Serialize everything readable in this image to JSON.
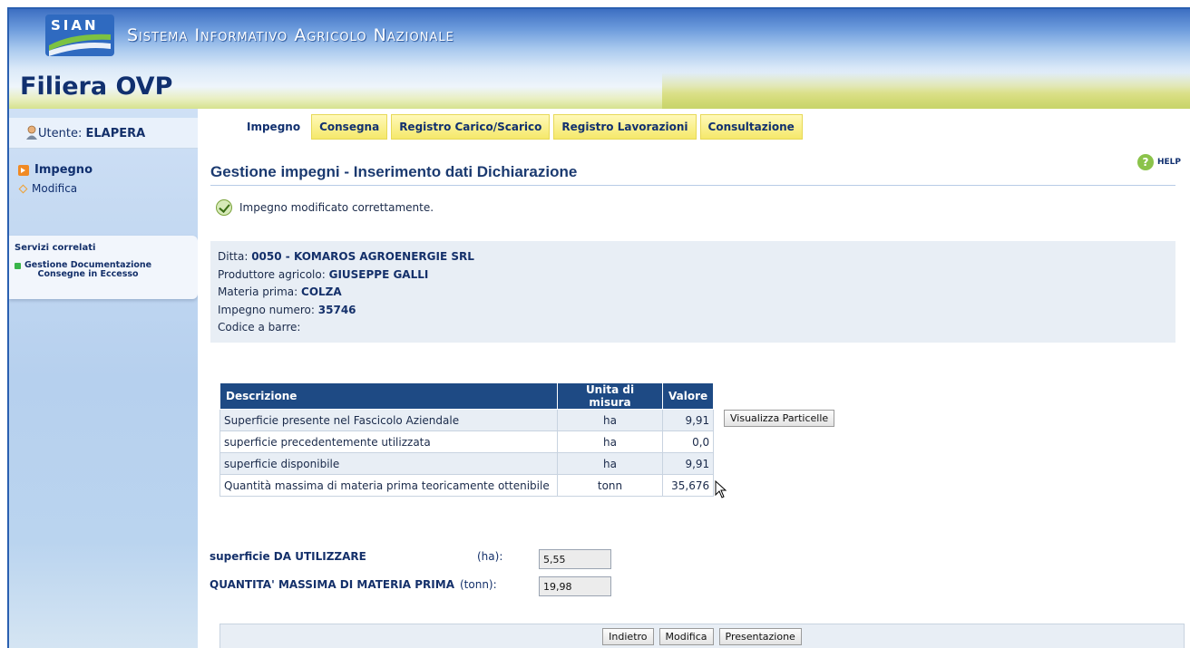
{
  "header": {
    "logo_text": "SIAN",
    "system_title": "Sistema Informativo Agricolo Nazionale",
    "app_title": "Filiera OVP"
  },
  "sidebar": {
    "user_prefix": "Utente: ",
    "user_name": "ELAPERA",
    "nav": [
      {
        "label": "Impegno",
        "active": true
      },
      {
        "label": "Modifica",
        "active": false
      }
    ],
    "services_title": "Servizi correlati",
    "services_item_line1": "Gestione Documentazione",
    "services_item_line2": "Consegne in Eccesso"
  },
  "tabs": [
    "Impegno",
    "Consegna",
    "Registro Carico/Scarico",
    "Registro Lavorazioni",
    "Consultazione"
  ],
  "help_label": "HELP",
  "page_title": "Gestione impegni - Inserimento dati Dichiarazione",
  "message": "Impegno modificato correttamente.",
  "info": {
    "ditta_label": "Ditta: ",
    "ditta_value": "0050 - KOMAROS AGROENERGIE SRL",
    "produttore_label": "Produttore agricolo: ",
    "produttore_value": "GIUSEPPE GALLI",
    "materia_label": "Materia prima: ",
    "materia_value": "COLZA",
    "impegno_label": "Impegno numero: ",
    "impegno_value": "35746",
    "codice_label": "Codice a barre:",
    "codice_value": ""
  },
  "table": {
    "headers": [
      "Descrizione",
      "Unita di misura",
      "Valore"
    ],
    "rows": [
      [
        "Superficie presente nel Fascicolo Aziendale",
        "ha",
        "9,91"
      ],
      [
        "superficie precedentemente utilizzata",
        "ha",
        "0,0"
      ],
      [
        "superficie disponibile",
        "ha",
        "9,91"
      ],
      [
        "Quantità massima di materia prima teoricamente ottenibile",
        "tonn",
        "35,676"
      ]
    ]
  },
  "visualizza_button": "Visualizza Particelle",
  "fields": {
    "superficie_label": "superficie DA UTILIZZARE",
    "superficie_unit": "(ha):",
    "superficie_value": "5,55",
    "quantita_label": "QUANTITA' MASSIMA DI MATERIA PRIMA",
    "quantita_unit": "(tonn):",
    "quantita_value": "19,98"
  },
  "buttons": {
    "indietro": "Indietro",
    "modifica": "Modifica",
    "presentazione": "Presentazione"
  },
  "colors": {
    "header_blue": "#2a5fb0",
    "title_navy": "#11306f",
    "tab_yellow": "#f5e86a",
    "table_header": "#1e4a84",
    "ok_green": "#7aa33a"
  }
}
